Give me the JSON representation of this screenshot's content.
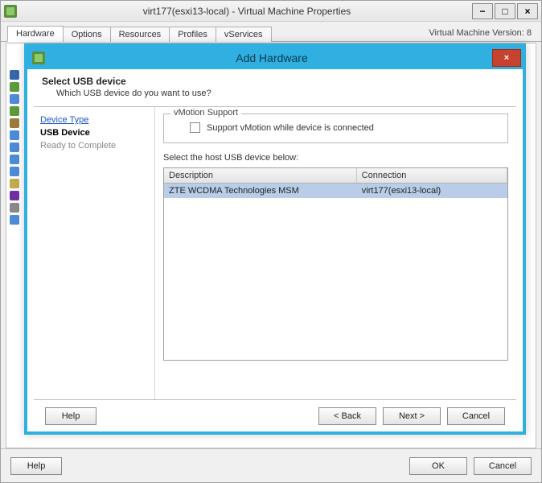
{
  "parent": {
    "title": "virt177(esxi13-local) - Virtual Machine Properties",
    "tabs": [
      "Hardware",
      "Options",
      "Resources",
      "Profiles",
      "vServices"
    ],
    "version_label": "Virtual Machine Version: 8",
    "buttons": {
      "help": "Help",
      "ok": "OK",
      "cancel": "Cancel"
    },
    "win_controls": {
      "min": "−",
      "max": "□",
      "close": "×"
    }
  },
  "dialog": {
    "title": "Add Hardware",
    "close": "×",
    "header_title": "Select USB device",
    "header_sub": "Which USB device do you want to use?",
    "nav": {
      "device_type": "Device Type",
      "usb_device": "USB Device",
      "ready": "Ready to Complete"
    },
    "group_legend": "vMotion Support",
    "vmotion_label": "Support vMotion while device is connected",
    "list_label": "Select the host USB device below:",
    "columns": {
      "desc": "Description",
      "conn": "Connection"
    },
    "rows": [
      {
        "desc": "ZTE WCDMA Technologies MSM",
        "conn": "virt177(esxi13-local)"
      }
    ],
    "buttons": {
      "help": "Help",
      "back": "< Back",
      "next": "Next >",
      "cancel": "Cancel"
    }
  }
}
